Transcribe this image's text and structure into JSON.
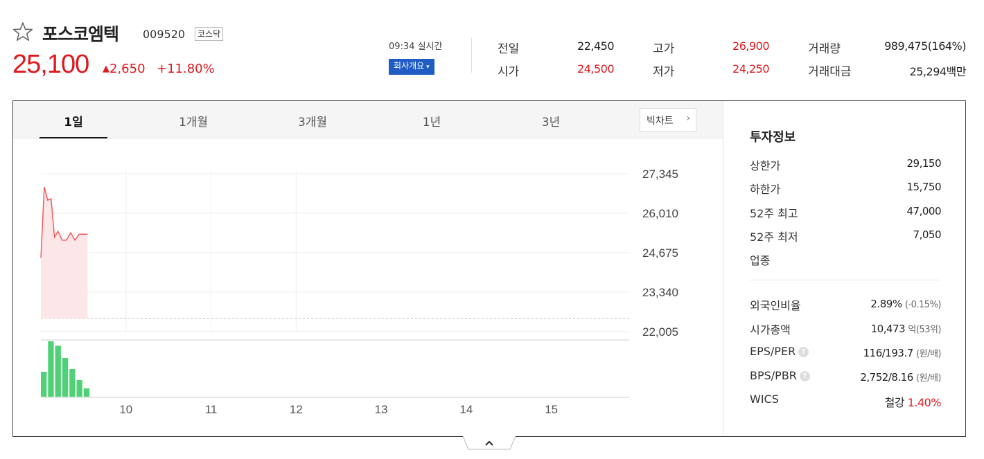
{
  "stock": {
    "name": "포스코엠텍",
    "code": "009520",
    "market": "코스닥",
    "price": "25,100",
    "change_arrow": "▲",
    "change": "2,650",
    "change_pct": "+11.80%"
  },
  "realtime": {
    "time": "09:34 실시간",
    "company_button": "회사개요",
    "company_caret": "▾"
  },
  "quote": {
    "prev_close": {
      "label": "전일",
      "value": "22,450"
    },
    "open": {
      "label": "시가",
      "value": "24,500"
    },
    "high": {
      "label": "고가",
      "value": "26,900"
    },
    "low": {
      "label": "저가",
      "value": "24,250"
    },
    "volume": {
      "label": "거래량",
      "value": "989,475(164%)"
    },
    "amount": {
      "label": "거래대금",
      "value": "25,294백만"
    }
  },
  "tabs": [
    "1일",
    "1개월",
    "3개월",
    "1년",
    "3년"
  ],
  "bigchart_label": "빅차트",
  "bigchart_chev": "›",
  "chart_data": {
    "type": "area",
    "y_ticks": [
      "27,345",
      "26,010",
      "24,675",
      "23,340",
      "22,005"
    ],
    "ylim": [
      22005,
      27345
    ],
    "x_ticks": [
      "10",
      "11",
      "12",
      "13",
      "14",
      "15"
    ],
    "x_range_hours": [
      9,
      15.5
    ],
    "price_series": {
      "x": [
        9.0,
        9.04,
        9.08,
        9.12,
        9.16,
        9.2,
        9.25,
        9.3,
        9.35,
        9.4,
        9.45,
        9.5,
        9.55
      ],
      "y": [
        24500,
        26900,
        26450,
        26500,
        25200,
        25400,
        25100,
        25100,
        25350,
        25100,
        25300,
        25300,
        25300
      ]
    },
    "prev_close_line": 22450,
    "volume_series": {
      "x": [
        9.0,
        9.05,
        9.1,
        9.15,
        9.2,
        9.25,
        9.3
      ],
      "values": [
        45,
        100,
        92,
        70,
        50,
        30,
        15
      ]
    },
    "colors": {
      "line": "#f45a5a",
      "area": "#fde6e8",
      "volume": "#4fd176"
    }
  },
  "invest": {
    "title": "투자정보",
    "upper_limit": {
      "label": "상한가",
      "value": "29,150"
    },
    "lower_limit": {
      "label": "하한가",
      "value": "15,750"
    },
    "high52": {
      "label": "52주 최고",
      "value": "47,000"
    },
    "low52": {
      "label": "52주 최저",
      "value": "7,050"
    },
    "sector": {
      "label": "업종"
    },
    "foreign": {
      "label": "외국인비율",
      "value": "2.89%",
      "sub": "(-0.15%)"
    },
    "mktcap": {
      "label": "시가총액",
      "value": "10,473",
      "sub": "억(53위)"
    },
    "eps_per": {
      "label": "EPS/PER",
      "value": "116/193.7",
      "sub": "(원/배)"
    },
    "bps_pbr": {
      "label": "BPS/PBR",
      "value": "2,752/8.16",
      "sub": "(원/배)"
    },
    "wics": {
      "label": "WICS",
      "value": "철강",
      "pct": "1.40%"
    },
    "help": "?"
  }
}
